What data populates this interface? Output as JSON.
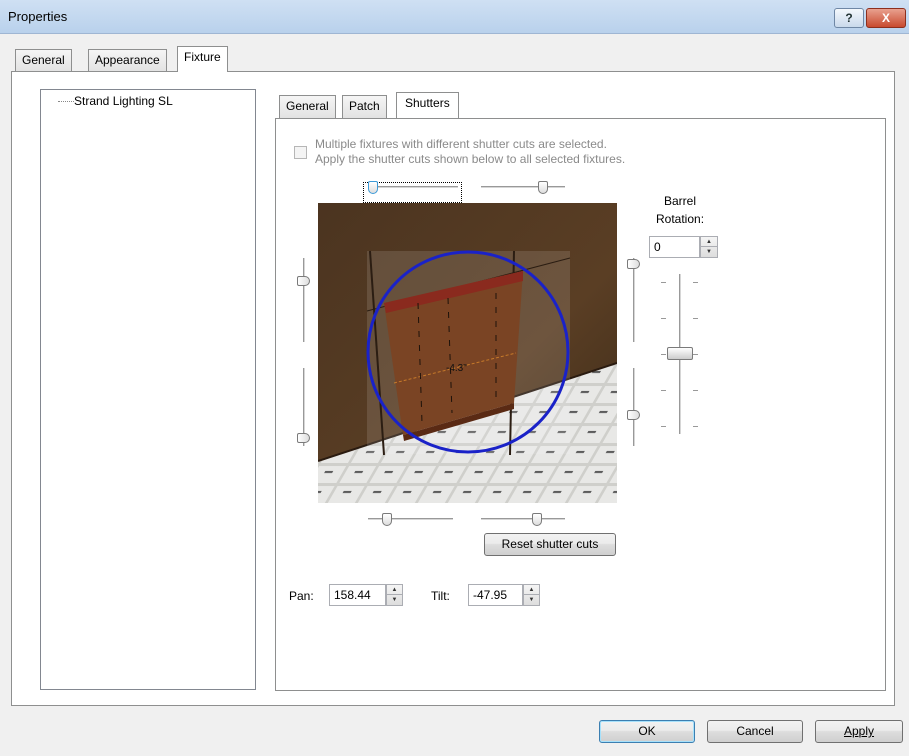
{
  "window": {
    "title": "Properties",
    "help_label": "?",
    "close_label": "X"
  },
  "tabs": [
    "General",
    "Appearance",
    "Fixture"
  ],
  "tree": {
    "items": [
      "Strand Lighting SL"
    ]
  },
  "subtabs": [
    "General",
    "Patch",
    "Shutters"
  ],
  "shutters": {
    "multi_line1": "Multiple fixtures with different shutter cuts are selected.",
    "multi_line2": "Apply the shutter cuts shown below to all selected fixtures.",
    "barrel_label_1": "Barrel",
    "barrel_label_2": "Rotation:",
    "barrel_value": "0",
    "viewport_readout": "-4.3\"",
    "reset_label": "Reset shutter cuts",
    "pan_label": "Pan:",
    "pan_value": "158.44",
    "tilt_label": "Tilt:",
    "tilt_value": "-47.95"
  },
  "buttons": {
    "ok": "OK",
    "cancel": "Cancel",
    "apply": "Apply"
  },
  "colors": {
    "beam_circle": "#1a22c8",
    "fixture_frame": "#8a2a1e",
    "titlebar": "#c3d7ef"
  }
}
